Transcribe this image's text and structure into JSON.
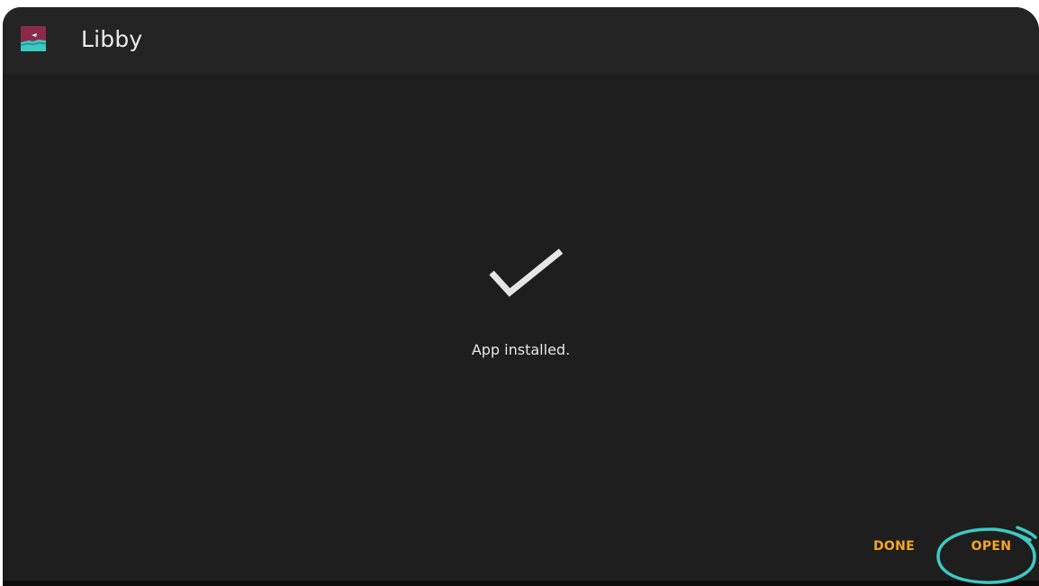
{
  "header": {
    "app_title": "Libby",
    "app_icon": "libby-app-icon"
  },
  "main": {
    "status_icon": "checkmark-icon",
    "status_text": "App installed."
  },
  "actions": {
    "done_label": "DONE",
    "open_label": "OPEN"
  },
  "colors": {
    "background": "#1e1e1e",
    "titlebar": "#242424",
    "accent": "#f5a623",
    "annotation": "#3ec9c2"
  }
}
